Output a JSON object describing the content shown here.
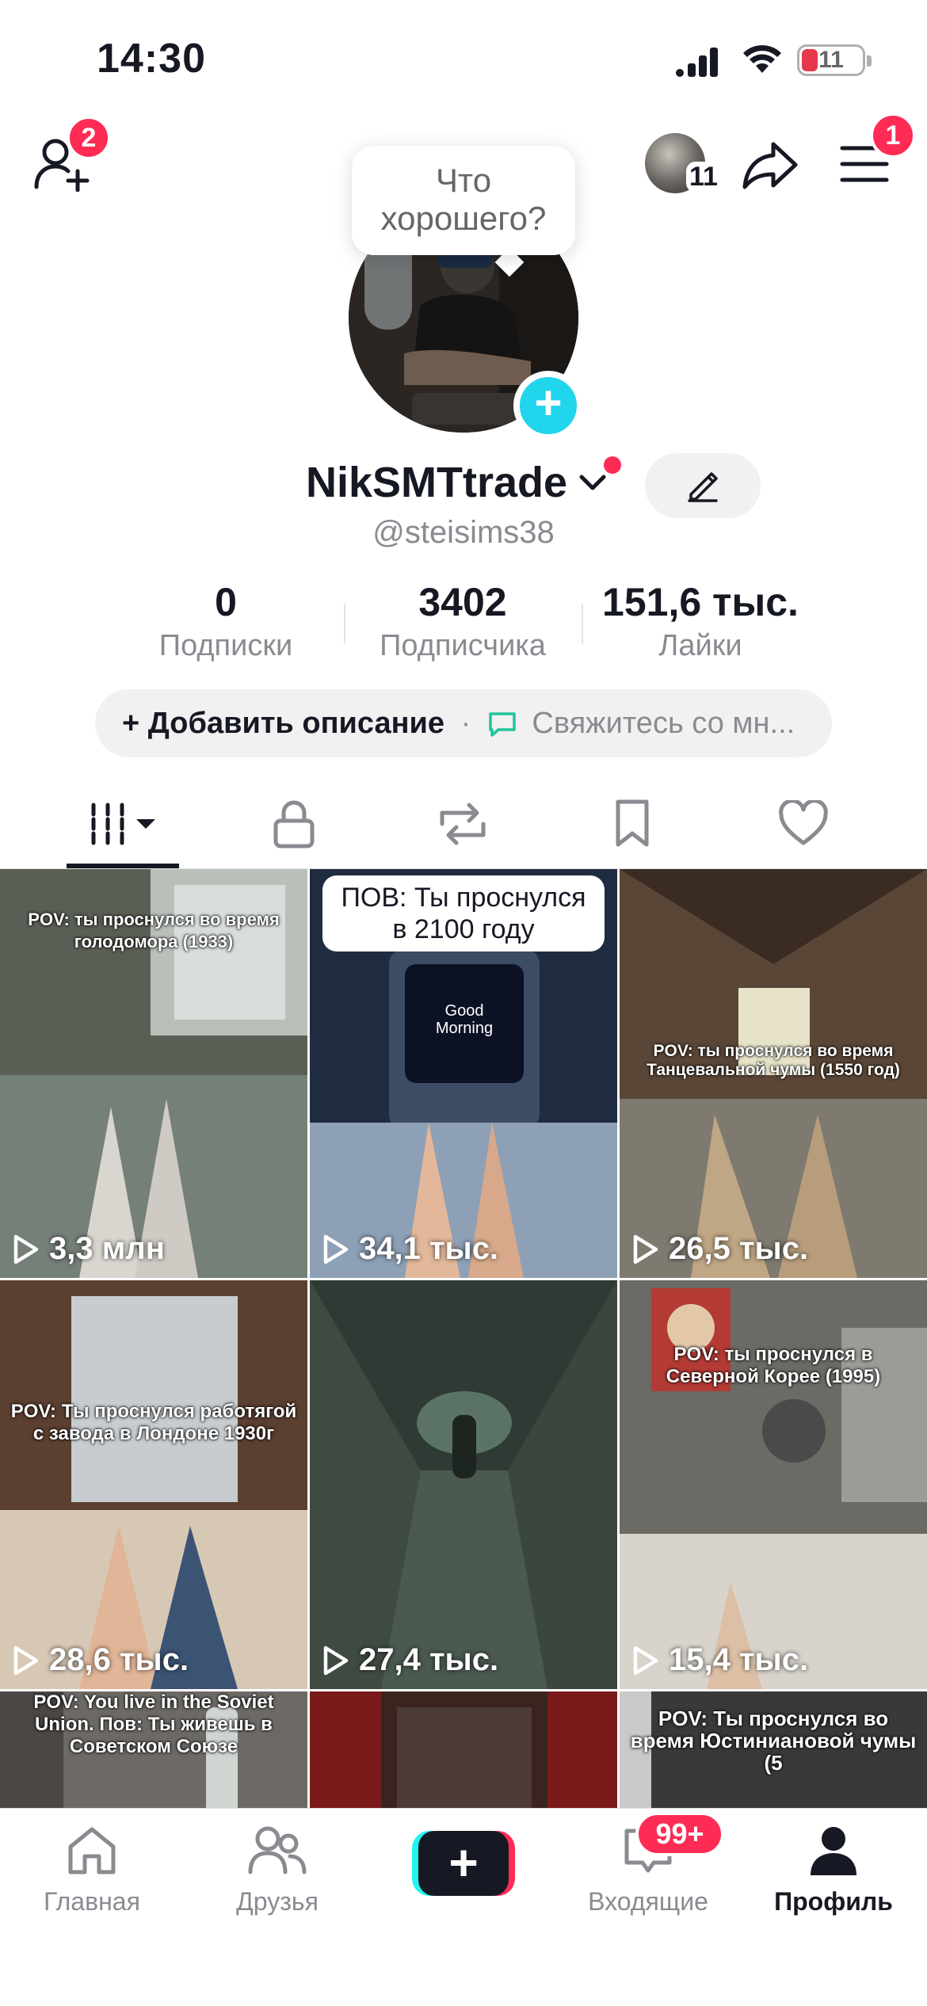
{
  "status": {
    "time": "14:30",
    "battery": "11"
  },
  "top_nav": {
    "add_friends_badge": "2",
    "story_count": "11",
    "menu_badge": "1"
  },
  "profile": {
    "bubble_text": "Что хорошего?",
    "username": "NikSMTtrade",
    "handle": "@steisims38",
    "stats": [
      {
        "value": "0",
        "label": "Подписки"
      },
      {
        "value": "3402",
        "label": "Подписчика"
      },
      {
        "value": "151,6 тыс.",
        "label": "Лайки"
      }
    ],
    "add_bio": "+ Добавить описание",
    "separator": "·",
    "contact": "Свяжитесь со мн..."
  },
  "tabs": [
    {
      "icon": "videos-grid-icon",
      "active": true
    },
    {
      "icon": "lock-icon",
      "active": false
    },
    {
      "icon": "repost-icon",
      "active": false
    },
    {
      "icon": "bookmark-icon",
      "active": false
    },
    {
      "icon": "heart-icon",
      "active": false
    }
  ],
  "videos": [
    {
      "caption": "POV: ты проснулся во время голодомора (1933)",
      "views": "3,3 млн",
      "bg": "#5a5f55"
    },
    {
      "caption": "ПОВ: Ты проснулся в 2100 году",
      "views": "34,1 тыс.",
      "bg": "#2a3a55",
      "screen_text": "Good Morning"
    },
    {
      "caption": "POV: ты проснулся во время Танцевальной чумы (1550 год)",
      "views": "26,5 тыс.",
      "bg": "#6b5640"
    },
    {
      "caption": "POV: Ты проснулся работягой с завода в Лондоне 1930г",
      "views": "28,6 тыс.",
      "bg": "#6a4f3c"
    },
    {
      "caption": "",
      "views": "27,4 тыс.",
      "bg": "#3a4a40"
    },
    {
      "caption": "POV: ты проснулся в Северной Корее (1995)",
      "views": "15,4 тыс.",
      "bg": "#7a7670"
    },
    {
      "caption": "POV: You live in the Soviet Union. Пов: Ты живешь в Советском Союзе",
      "views": "",
      "bg": "#6d6a66"
    },
    {
      "caption": "",
      "views": "",
      "bg": "#3b2420"
    },
    {
      "caption": "POV: Ты проснулся во время Юстиниановой чумы (5",
      "views": "",
      "bg": "#3a3838"
    }
  ],
  "bottom_nav": {
    "home": "Главная",
    "friends": "Друзья",
    "inbox": "Входящие",
    "inbox_badge": "99+",
    "profile": "Профиль"
  },
  "colors": {
    "accent_red": "#fe2c55",
    "accent_cyan": "#25f4ee",
    "text_primary": "#161823",
    "text_secondary": "#8a8b91"
  }
}
